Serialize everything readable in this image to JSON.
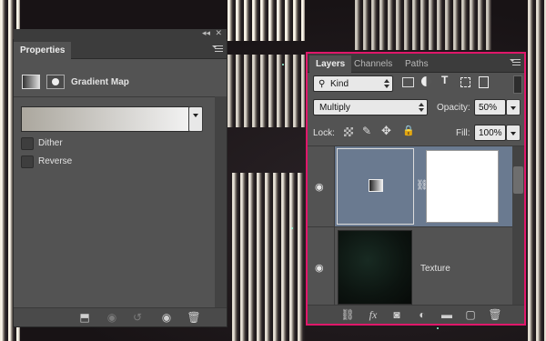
{
  "properties_panel": {
    "tab_label": "Properties",
    "title": "Gradient Map",
    "dither_label": "Dither",
    "reverse_label": "Reverse"
  },
  "layers_panel": {
    "tabs": [
      {
        "label": "Layers"
      },
      {
        "label": "Channels"
      },
      {
        "label": "Paths"
      }
    ],
    "filter_kind": "Kind",
    "blend_mode": "Multiply",
    "opacity_label": "Opacity:",
    "opacity_value": "50%",
    "lock_label": "Lock:",
    "fill_label": "Fill:",
    "fill_value": "100%",
    "layers": [
      {
        "name": "",
        "type": "gradient-map-adjustment",
        "selected": true,
        "visible": true
      },
      {
        "name": "Texture",
        "type": "image",
        "selected": false,
        "visible": true
      }
    ]
  },
  "colors": {
    "panel_bg": "#535353",
    "selected_layer": "#6a7a90",
    "highlight_border": "#e0176a"
  }
}
